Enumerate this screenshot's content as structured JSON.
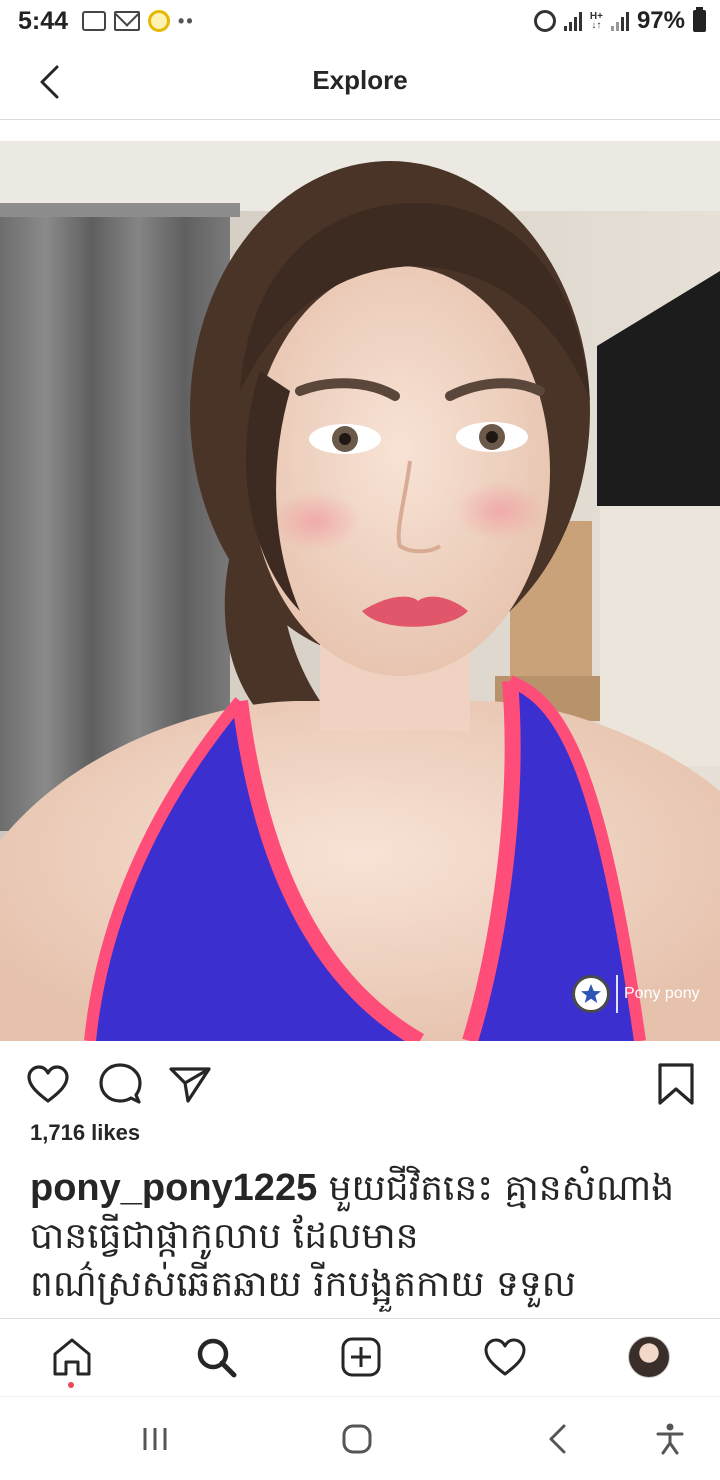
{
  "status_bar": {
    "time": "5:44",
    "battery": "97%",
    "icons": [
      "calendar-icon",
      "gmail-icon",
      "notification-icon",
      "more-dots",
      "alarm-icon",
      "signal-icon",
      "h-plus-icon",
      "battery-icon"
    ]
  },
  "header": {
    "title": "Explore"
  },
  "post": {
    "watermark_text": "Pony pony",
    "likes": "1,716 likes",
    "username": "pony_pony1225",
    "caption": " មួយជីវិតនេះ គ្មានសំណាងបានធ្វើជាផ្កាកូលាប ដែលមានពណ៌ស្រស់ឆើតឆាយ រីកបង្អួតកាយ ទទួល"
  },
  "colors": {
    "tank_top": "#3b2fd0",
    "tank_trim": "#ff4d7a",
    "notification_dot": "#ed4956"
  }
}
